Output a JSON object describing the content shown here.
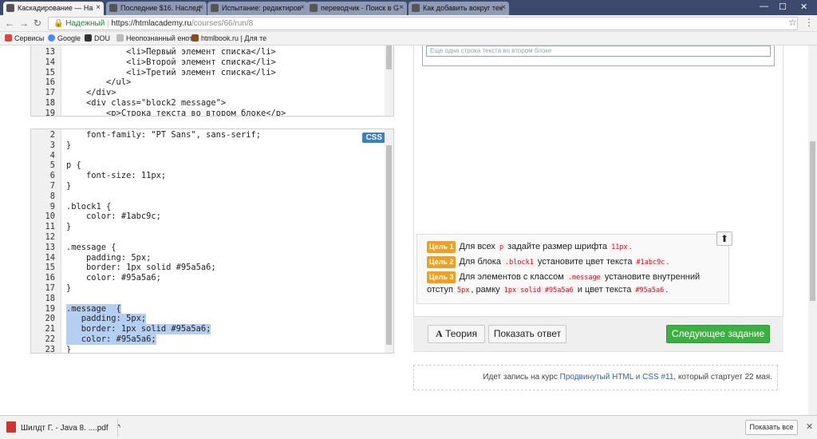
{
  "browser": {
    "tabs": [
      {
        "label": "Каскадирование — На",
        "active": true
      },
      {
        "label": "Последние $16. Наслед",
        "active": false
      },
      {
        "label": "Испытание: редактиров",
        "active": false
      },
      {
        "label": "переводчик - Поиск в G",
        "active": false
      },
      {
        "label": "Как добавить вокруг тек",
        "active": false
      }
    ],
    "secure_label": "Надежный",
    "url_host": "https://htmlacademy.ru",
    "url_path": "/courses/66/run/8",
    "bookmarks": [
      "Сервисы",
      "Google",
      "DOU",
      "Неопознанный енот",
      "htmlbook.ru | Для те"
    ]
  },
  "html_editor": {
    "lines": [
      {
        "n": "13",
        "code": "            <li>Первый элемент списка</li>"
      },
      {
        "n": "14",
        "code": "            <li>Второй элемент списка</li>"
      },
      {
        "n": "15",
        "code": "            <li>Третий элемент списка</li>"
      },
      {
        "n": "16",
        "code": "        </ul>"
      },
      {
        "n": "17",
        "code": "    </div>"
      },
      {
        "n": "18",
        "code": "    <div class=\"block2 message\">"
      },
      {
        "n": "19",
        "code": "        <p>Строка текста во втором блоке</p>"
      }
    ]
  },
  "css_editor": {
    "badge": "CSS",
    "lines": [
      {
        "n": "2",
        "code": "    font-family: \"PT Sans\", sans-serif;",
        "hl": false
      },
      {
        "n": "3",
        "code": "}",
        "hl": false
      },
      {
        "n": "4",
        "code": "",
        "hl": false
      },
      {
        "n": "5",
        "code": "p {",
        "hl": false
      },
      {
        "n": "6",
        "code": "    font-size: 11px;",
        "hl": false
      },
      {
        "n": "7",
        "code": "}",
        "hl": false
      },
      {
        "n": "8",
        "code": "",
        "hl": false
      },
      {
        "n": "9",
        "code": ".block1 {",
        "hl": false
      },
      {
        "n": "10",
        "code": "    color: #1abc9c;",
        "hl": false
      },
      {
        "n": "11",
        "code": "}",
        "hl": false
      },
      {
        "n": "12",
        "code": "",
        "hl": false
      },
      {
        "n": "13",
        "code": ".message {",
        "hl": false
      },
      {
        "n": "14",
        "code": "    padding: 5px;",
        "hl": false
      },
      {
        "n": "15",
        "code": "    border: 1px solid #95a5a6;",
        "hl": false
      },
      {
        "n": "16",
        "code": "    color: #95a5a6;",
        "hl": false
      },
      {
        "n": "17",
        "code": "}",
        "hl": false
      },
      {
        "n": "18",
        "code": "",
        "hl": false
      },
      {
        "n": "19",
        "code": ".message  {",
        "hl": true
      },
      {
        "n": "20",
        "code": "   padding: 5px;",
        "hl": true
      },
      {
        "n": "21",
        "code": "   border: 1px solid #95a5a6;",
        "hl": true
      },
      {
        "n": "22",
        "code": "   color: #95a5a6;",
        "hl": true
      },
      {
        "n": "23",
        "code": "}",
        "hl": false
      }
    ]
  },
  "preview": {
    "text": "Еще одна строка текста во втором блоке"
  },
  "goals": [
    {
      "badge": "Цель 1",
      "parts": [
        "Для всех ",
        {
          "code": "p"
        },
        " задайте размер шрифта ",
        {
          "code": "11px"
        },
        "."
      ]
    },
    {
      "badge": "Цель 2",
      "parts": [
        "Для блока ",
        {
          "code": ".block1"
        },
        " установите цвет текста ",
        {
          "code": "#1abc9c"
        },
        "."
      ]
    },
    {
      "badge": "Цель 3",
      "parts": [
        "Для элементов с классом ",
        {
          "code": ".message"
        },
        " установите внутренний отступ ",
        {
          "code": "5px"
        },
        ", рамку ",
        {
          "code": "1px solid #95a5a6"
        },
        " и цвет текста ",
        {
          "code": "#95a5a6"
        },
        "."
      ]
    }
  ],
  "actions": {
    "theory": "Теория",
    "show_answer": "Показать ответ",
    "next": "Следующее задание"
  },
  "course": {
    "prefix": "Идет запись на курс ",
    "link": "Продвинутый HTML и CSS #11",
    "suffix": ", который стартует 22 мая."
  },
  "downloads": {
    "file": "Шилдт Г. - Java 8. ....pdf",
    "show_all": "Показать все"
  },
  "colors": {
    "accent_green": "#3cb043",
    "goal_badge": "#f0a020",
    "selection": "#b5cff2"
  }
}
